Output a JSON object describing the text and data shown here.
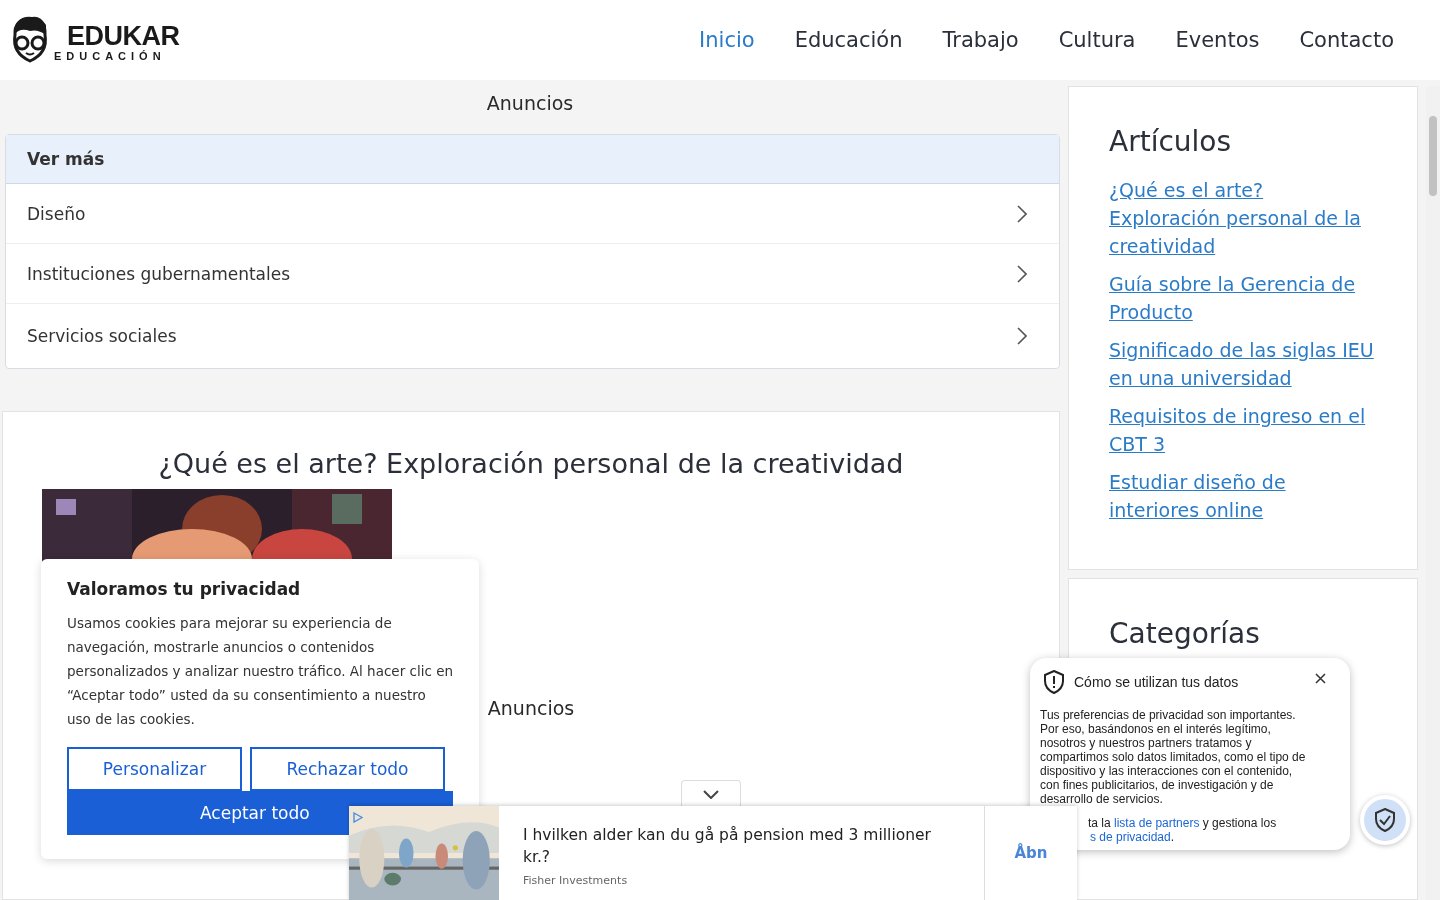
{
  "logo": {
    "name": "EDUKAR",
    "tagline": "EDUCACIÓN"
  },
  "nav": [
    {
      "label": "Inicio",
      "selected": true
    },
    {
      "label": "Educación",
      "selected": false
    },
    {
      "label": "Trabajo",
      "selected": false
    },
    {
      "label": "Cultura",
      "selected": false
    },
    {
      "label": "Eventos",
      "selected": false
    },
    {
      "label": "Contacto",
      "selected": false
    }
  ],
  "ads_label": "Anuncios",
  "accordion": {
    "title": "Ver más",
    "items": [
      "Diseño",
      "Instituciones gubernamentales",
      "Servicios sociales"
    ]
  },
  "article": {
    "title": "¿Qué es el arte? Exploración personal de la creatividad",
    "ads_label": "Anuncios"
  },
  "sidebar": {
    "articles_title": "Artículos",
    "articles": [
      "¿Qué es el arte? Exploración personal de la creatividad",
      "Guía sobre la Gerencia de Producto",
      "Significado de las siglas IEU en una universidad",
      "Requisitos de ingreso en el CBT 3",
      "Estudiar diseño de interiores online"
    ],
    "categories_title": "Categorías"
  },
  "cookie_dialog": {
    "title": "Valoramos tu privacidad",
    "text": "Usamos cookies para mejorar su experiencia de navegación, mostrarle anuncios o contenidos personalizados y analizar nuestro tráfico. Al hacer clic en “Aceptar todo” usted da su consentimiento a nuestro uso de las cookies.",
    "buttons": [
      "Personalizar",
      "Rechazar todo"
    ],
    "accept": "Aceptar todo"
  },
  "ad_bar": {
    "headline": "I hvilken alder kan du gå på pension med 3 millioner kr.?",
    "advertiser": "Fisher Investments",
    "action": "Åbn"
  },
  "privacy_popup": {
    "title": "Cómo se utilizan tus datos",
    "text": "Tus preferencias de privacidad son importantes. Por eso, basándonos en el interés legítimo, nosotros y nuestros partners tratamos y compartimos solo datos limitados, como el tipo de dispositivo y las interacciones con el contenido, con fines publicitarios, de investigación y de desarrollo de servicios.",
    "line1_before": "ta la",
    "line1_link": "lista de partners",
    "line1_after": "y gestiona los",
    "line2_link": "s de privacidad",
    "line2_after": "."
  }
}
